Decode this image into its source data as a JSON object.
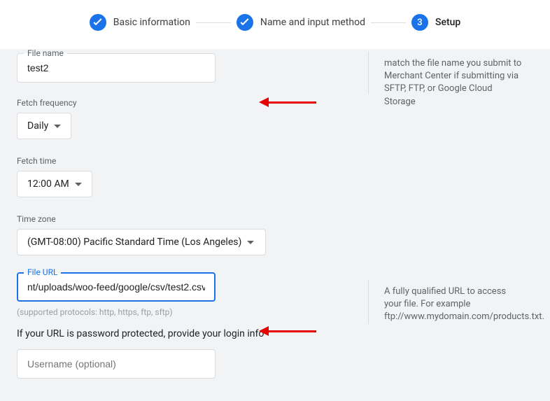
{
  "stepper": {
    "step1": "Basic information",
    "step2": "Name and input method",
    "step3_num": "3",
    "step3": "Setup"
  },
  "filename": {
    "label": "File name",
    "value": "test2"
  },
  "fetch_frequency": {
    "label": "Fetch frequency",
    "value": "Daily"
  },
  "fetch_time": {
    "label": "Fetch time",
    "value": "12:00 AM"
  },
  "timezone": {
    "label": "Time zone",
    "value": "(GMT-08:00) Pacific Standard Time (Los Angeles)"
  },
  "file_url": {
    "label": "File URL",
    "value": "nt/uploads/woo-feed/google/csv/test2.csv"
  },
  "protocols_hint": "(supported protocols: http, https, ftp, sftp)",
  "password_prompt": "If your URL is password protected, provide your login info",
  "username_placeholder": "Username (optional)",
  "help1": "match the file name you submit to Merchant Center if submitting via SFTP, FTP, or Google Cloud Storage",
  "help2": "A fully qualified URL to access your file. For example ftp://www.mydomain.com/products.txt."
}
